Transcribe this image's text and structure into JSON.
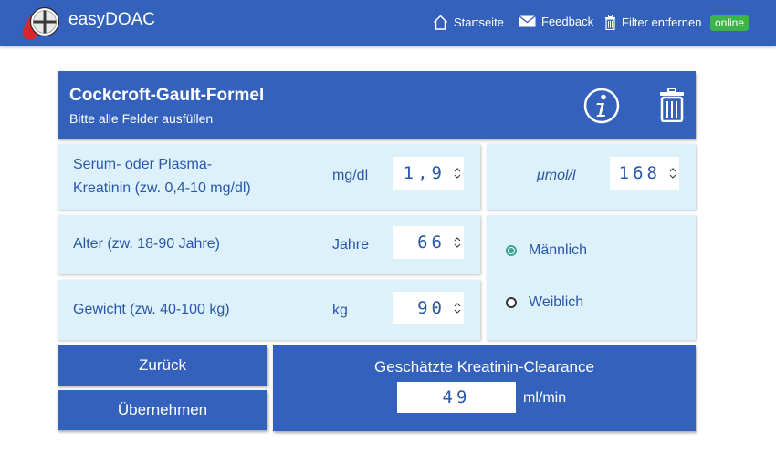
{
  "app": {
    "title": "easyDOAC",
    "status": "online"
  },
  "nav": {
    "home": "Startseite",
    "feedback": "Feedback",
    "filter": "Filter entfernen"
  },
  "card": {
    "title": "Cockcroft-Gault-Formel",
    "subtitle": "Bitte alle Felder ausfüllen"
  },
  "fields": {
    "creatinine": {
      "label_line1": "Serum- oder Plasma-",
      "label_line2": "Kreatinin (zw. 0,4-10 mg/dl)",
      "unit": "mg/dl",
      "value": "1,9"
    },
    "creatinine_umol": {
      "unit": "μmol/l",
      "value": "168"
    },
    "age": {
      "label": "Alter (zw. 18-90 Jahre)",
      "unit": "Jahre",
      "value": "66"
    },
    "weight": {
      "label": "Gewicht (zw. 40-100 kg)",
      "unit": "kg",
      "value": "90"
    }
  },
  "sex": {
    "male": "Männlich",
    "female": "Weiblich",
    "selected": "male"
  },
  "buttons": {
    "back": "Zurück",
    "apply": "Übernehmen"
  },
  "result": {
    "title": "Geschätzte Kreatinin-Clearance",
    "value": "49",
    "unit": "ml/min"
  },
  "colors": {
    "primary": "#3461bb",
    "panel": "#ddf1fb",
    "text": "#2b57a8",
    "online": "#3cb44a",
    "radio": "#3aa39a"
  }
}
